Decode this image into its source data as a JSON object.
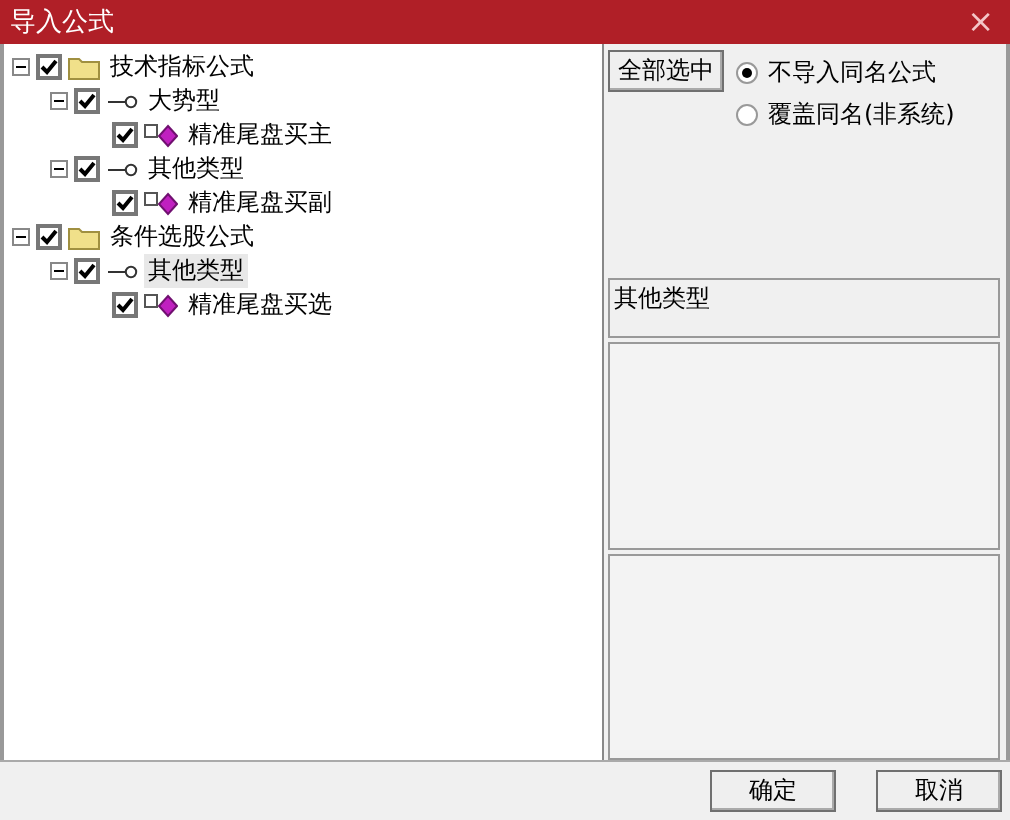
{
  "window": {
    "title": "导入公式",
    "close": "×"
  },
  "tree": [
    {
      "label": "技术指标公式",
      "kind": "folder",
      "expanded": true,
      "checked": true,
      "selected": false,
      "children": [
        {
          "label": "大势型",
          "kind": "category",
          "expanded": true,
          "checked": true,
          "selected": false,
          "children": [
            {
              "label": "精准尾盘买主",
              "kind": "formula",
              "checked": true,
              "selected": false
            }
          ]
        },
        {
          "label": "其他类型",
          "kind": "category",
          "expanded": true,
          "checked": true,
          "selected": false,
          "children": [
            {
              "label": "精准尾盘买副",
              "kind": "formula",
              "checked": true,
              "selected": false
            }
          ]
        }
      ]
    },
    {
      "label": "条件选股公式",
      "kind": "folder",
      "expanded": true,
      "checked": true,
      "selected": false,
      "children": [
        {
          "label": "其他类型",
          "kind": "category",
          "expanded": true,
          "checked": true,
          "selected": true,
          "children": [
            {
              "label": "精准尾盘买选",
              "kind": "formula",
              "checked": true,
              "selected": false
            }
          ]
        }
      ]
    }
  ],
  "select_all_button": "全部选中",
  "options": [
    {
      "label": "不导入同名公式",
      "selected": true
    },
    {
      "label": "覆盖同名(非系统)",
      "selected": false
    }
  ],
  "category_field": {
    "value": "其他类型"
  },
  "buttons": [
    "确定",
    "取消"
  ]
}
